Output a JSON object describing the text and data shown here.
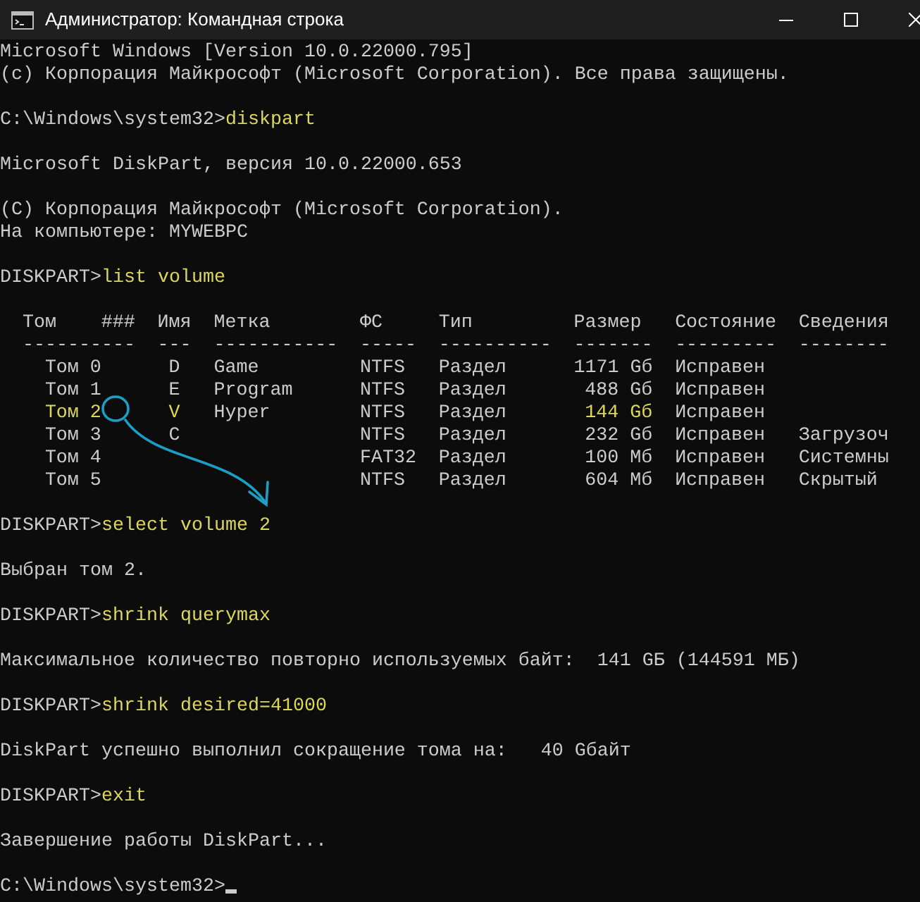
{
  "window": {
    "title": "Администратор: Командная строка"
  },
  "console": {
    "lines": [
      {
        "kind": "output",
        "text": "Microsoft Windows [Version 10.0.22000.795]"
      },
      {
        "kind": "output",
        "text": "(c) Корпорация Майкрософт (Microsoft Corporation). Все права защищены."
      },
      {
        "kind": "blank"
      },
      {
        "kind": "command",
        "prompt": "C:\\Windows\\system32>",
        "command": "diskpart"
      },
      {
        "kind": "blank"
      },
      {
        "kind": "output",
        "text": "Microsoft DiskPart, версия 10.0.22000.653"
      },
      {
        "kind": "blank"
      },
      {
        "kind": "output",
        "text": "(C) Корпорация Майкрософт (Microsoft Corporation)."
      },
      {
        "kind": "output",
        "text": "На компьютере: MYWEBPC"
      },
      {
        "kind": "blank"
      },
      {
        "kind": "command",
        "prompt": "DISKPART>",
        "command": "list volume"
      },
      {
        "kind": "blank"
      },
      {
        "kind": "table",
        "columns": [
          "Том",
          "###",
          "Имя",
          "Метка",
          "ФС",
          "Тип",
          "Размер",
          "Состояние",
          "Сведения"
        ],
        "rules": [
          "----------",
          "---",
          "-----------",
          "-----",
          "----------",
          "-------",
          "---------",
          "--------"
        ],
        "rows": [
          {
            "volume": "Том 0",
            "letter": "D",
            "label": "Game",
            "fs": "NTFS",
            "type": "Раздел",
            "size": "1171 Gб",
            "status": "Исправен",
            "selected": false
          },
          {
            "volume": "Том 1",
            "letter": "E",
            "label": "Program",
            "fs": "NTFS",
            "type": "Раздел",
            "size": "488 Gб",
            "status": "Исправен",
            "selected": false
          },
          {
            "volume": "Том 2",
            "letter": "V",
            "label": "Hyper",
            "fs": "NTFS",
            "type": "Раздел",
            "size": "144 Gб",
            "status": "Исправен",
            "selected": true
          },
          {
            "volume": "Том 3",
            "letter": "C",
            "fs": "NTFS",
            "type": "Раздел",
            "size": "232 Gб",
            "status": "Исправен",
            "info": "Загрузоч",
            "selected": false
          },
          {
            "volume": "Том 4",
            "fs": "FAT32",
            "type": "Раздел",
            "size": "100 Мб",
            "status": "Исправен",
            "info": "Системны",
            "selected": false
          },
          {
            "volume": "Том 5",
            "fs": "NTFS",
            "type": "Раздел",
            "size": "604 Мб",
            "status": "Исправен",
            "info": "Скрытый",
            "selected": false
          }
        ]
      },
      {
        "kind": "blank"
      },
      {
        "kind": "command",
        "prompt": "DISKPART>",
        "command": "select volume 2"
      },
      {
        "kind": "blank"
      },
      {
        "kind": "output",
        "text": "Выбран том 2."
      },
      {
        "kind": "blank"
      },
      {
        "kind": "command",
        "prompt": "DISKPART>",
        "command": "shrink querymax"
      },
      {
        "kind": "blank"
      },
      {
        "kind": "output",
        "text": "Максимальное количество повторно используемых байт:  141 GБ (144591 МБ)"
      },
      {
        "kind": "blank"
      },
      {
        "kind": "command",
        "prompt": "DISKPART>",
        "command": "shrink desired=41000"
      },
      {
        "kind": "blank"
      },
      {
        "kind": "output",
        "text": "DiskPart успешно выполнил сокращение тома на:   40 Gбайт"
      },
      {
        "kind": "blank"
      },
      {
        "kind": "command",
        "prompt": "DISKPART>",
        "command": "exit"
      },
      {
        "kind": "blank"
      },
      {
        "kind": "output",
        "text": "Завершение работы DiskPart..."
      },
      {
        "kind": "blank"
      },
      {
        "kind": "command",
        "prompt": "C:\\Windows\\system32>",
        "cursor": true
      }
    ]
  },
  "annotation": {
    "color": "#1c9fc4"
  }
}
